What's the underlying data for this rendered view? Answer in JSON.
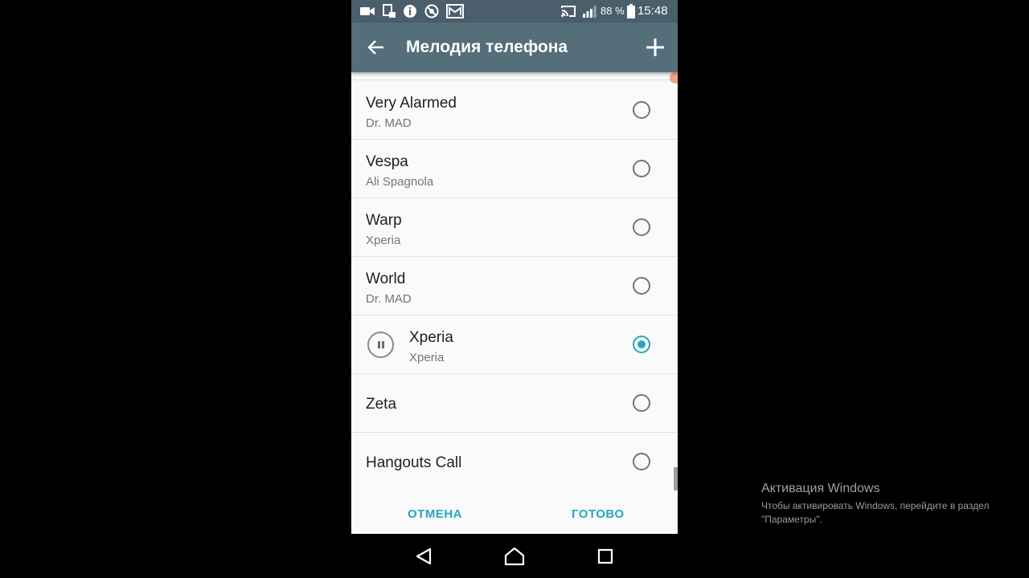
{
  "status_bar": {
    "battery_percent": "88 %",
    "time": "15:48",
    "left_icons": [
      "video-camera-icon",
      "screenshot-icon",
      "info-icon",
      "blocked-icon",
      "mail-icon"
    ],
    "right_icons": [
      "cast-icon",
      "signal-icon",
      "battery-icon"
    ]
  },
  "app_bar": {
    "title": "Мелодия телефона",
    "back_icon": "arrow-back-icon",
    "add_icon": "plus-icon"
  },
  "ringtones": [
    {
      "title": "Very Alarmed",
      "subtitle": "Dr. MAD",
      "selected": false,
      "playing": false
    },
    {
      "title": "Vespa",
      "subtitle": "Ali Spagnola",
      "selected": false,
      "playing": false
    },
    {
      "title": "Warp",
      "subtitle": "Xperia",
      "selected": false,
      "playing": false
    },
    {
      "title": "World",
      "subtitle": "Dr. MAD",
      "selected": false,
      "playing": false
    },
    {
      "title": "Xperia",
      "subtitle": "Xperia",
      "selected": true,
      "playing": true
    },
    {
      "title": "Zeta",
      "subtitle": "",
      "selected": false,
      "playing": false
    },
    {
      "title": "Hangouts Call",
      "subtitle": "",
      "selected": false,
      "playing": false
    }
  ],
  "dialog": {
    "cancel_label": "ОТМЕНА",
    "done_label": "ГОТОВО"
  },
  "colors": {
    "accent": "#26a7bd",
    "app_bar": "#546e7a",
    "status_bar": "#4a5e6c"
  },
  "watermark": {
    "title": "Активация Windows",
    "line1": "Чтобы активировать Windows, перейдите в раздел",
    "line2": "\"Параметры\"."
  }
}
